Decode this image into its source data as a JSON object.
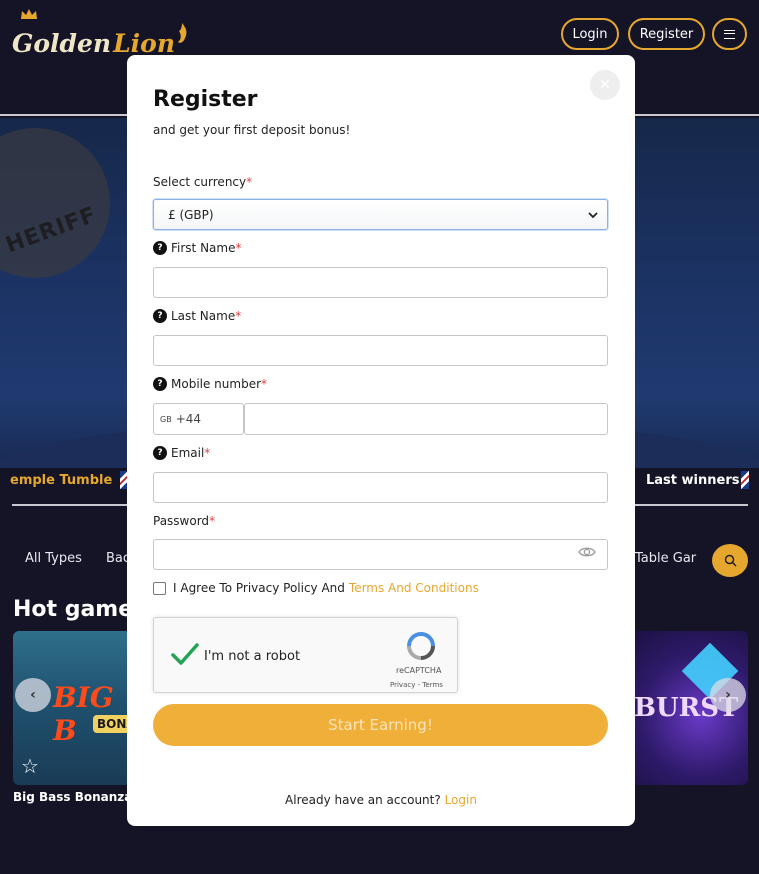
{
  "header": {
    "logo_golden": "Golden",
    "logo_lion": "Lion",
    "login_label": "Login",
    "register_label": "Register",
    "menu_icon": "hamburger-icon"
  },
  "banner": {
    "sheriff_text": "HERIFF"
  },
  "ticker": {
    "game_text": "emple Tumble",
    "winners_label": "Last winners:"
  },
  "game_types": {
    "tabs": [
      "All Types",
      "Bac",
      "Table Gar"
    ]
  },
  "hot_games": {
    "title": "Hot game",
    "games": [
      {
        "name": "Big Bass Bonanza",
        "logo": "BIG B",
        "sub": "BONA"
      },
      {
        "name": "",
        "logo": "BURST"
      }
    ]
  },
  "modal": {
    "title": "Register",
    "subtitle": "and get your first deposit bonus!",
    "close_icon": "close-icon",
    "currency": {
      "label": "Select currency",
      "required": "*",
      "value": "£ (GBP)"
    },
    "first_name": {
      "label": "First Name",
      "required": "*",
      "value": ""
    },
    "last_name": {
      "label": "Last Name",
      "required": "*",
      "value": ""
    },
    "mobile": {
      "label": "Mobile number",
      "required": "*",
      "country": "GB",
      "code": "+44",
      "value": ""
    },
    "email": {
      "label": "Email",
      "required": "*",
      "value": ""
    },
    "password": {
      "label": "Password",
      "required": "*",
      "value": ""
    },
    "agree": {
      "text": "I Agree To Privacy Policy And",
      "link": "Terms And Conditions",
      "checked": false
    },
    "captcha": {
      "label": "I'm not a robot",
      "brand": "reCAPTCHA",
      "links": "Privacy - Terms",
      "checked": true
    },
    "submit_label": "Start Earning!",
    "already_text": "Already have an account?",
    "already_login": "Login"
  },
  "colors": {
    "accent": "#e6a72f",
    "background": "#141426",
    "required": "#e04040"
  }
}
